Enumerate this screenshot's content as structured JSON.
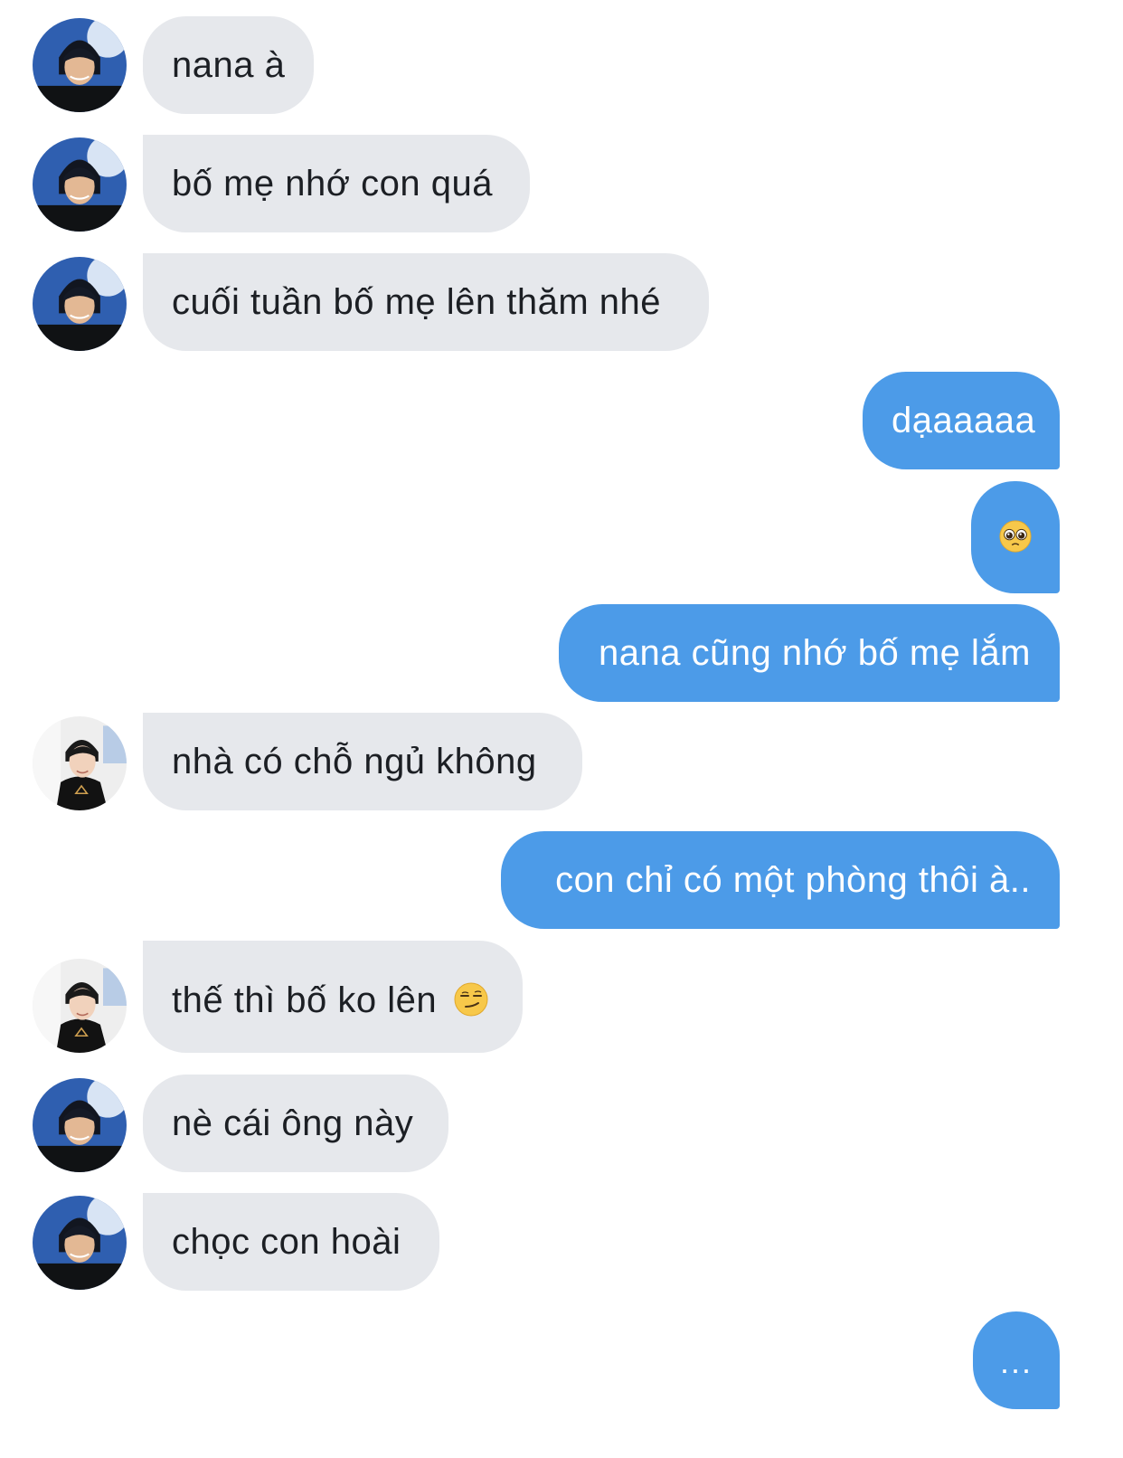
{
  "conversation": {
    "messages": [
      {
        "side": "in",
        "avatar": "avatar-a",
        "text": "nana à"
      },
      {
        "side": "in",
        "avatar": "avatar-a",
        "text": "bố mẹ nhớ con quá"
      },
      {
        "side": "in",
        "avatar": "avatar-a",
        "text": "cuối tuần bố mẹ lên thăm nhé"
      },
      {
        "side": "out",
        "text": "dạaaaaa"
      },
      {
        "side": "out",
        "emoji": "pleading-face-emoji"
      },
      {
        "side": "out",
        "text": "nana cũng nhớ bố mẹ lắm"
      },
      {
        "side": "in",
        "avatar": "avatar-b",
        "text": "nhà có chỗ ngủ không"
      },
      {
        "side": "out",
        "text": "con chỉ có một phòng thôi à.."
      },
      {
        "side": "in",
        "avatar": "avatar-b",
        "text": "thế thì bố ko lên",
        "emoji": "smirking-face-emoji"
      },
      {
        "side": "in",
        "avatar": "avatar-a",
        "text": "nè cái ông này"
      },
      {
        "side": "in",
        "avatar": "avatar-a",
        "text": "chọc con hoài"
      },
      {
        "side": "out",
        "text": "..."
      }
    ]
  },
  "colors": {
    "incoming_bubble": "#e6e8ec",
    "outgoing_bubble": "#4c9be8",
    "incoming_text": "#1c1f24",
    "outgoing_text": "#ffffff"
  }
}
